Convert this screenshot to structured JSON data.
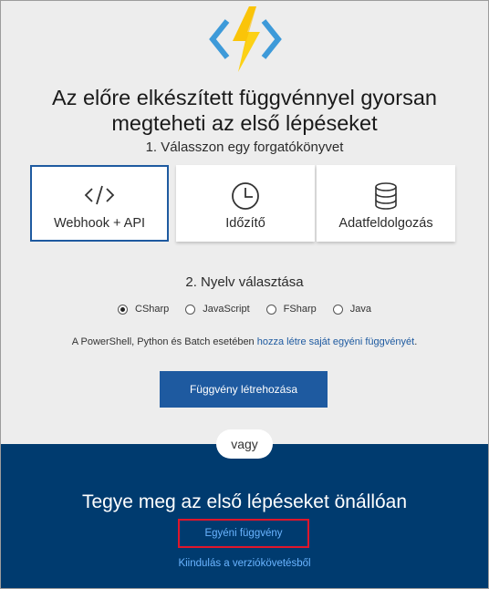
{
  "header": {
    "logo_icon": "azure-functions-lightning-icon",
    "headline_line1": "Az előre elkészített függvénnyel gyorsan",
    "headline_line2": "megteheti az első lépéseket",
    "step1_label": "1. Válasszon egy forgatókönyvet"
  },
  "scenarios": [
    {
      "label": "Webhook + API",
      "icon": "code-icon",
      "selected": true
    },
    {
      "label": "Időzítő",
      "icon": "clock-icon",
      "selected": false
    },
    {
      "label": "Adatfeldolgozás",
      "icon": "database-icon",
      "selected": false
    }
  ],
  "language": {
    "step2_label": "2. Nyelv választása",
    "options": [
      {
        "label": "CSharp",
        "checked": true
      },
      {
        "label": "JavaScript",
        "checked": false
      },
      {
        "label": "FSharp",
        "checked": false
      },
      {
        "label": "Java",
        "checked": false
      }
    ]
  },
  "note": {
    "prefix": "A PowerShell, Python és Batch esetében ",
    "link": "hozza létre saját egyéni függvényét",
    "suffix": "."
  },
  "create_button": "Függvény létrehozása",
  "divider_label": "vagy",
  "bottom": {
    "title": "Tegye meg az első lépéseket önállóan",
    "custom_function_link": "Egyéni függvény",
    "version_control_link": "Kiindulás a verziókövetésből"
  },
  "colors": {
    "accent_blue": "#1e5aa0",
    "dark_navy": "#003b6f",
    "highlight_red": "#e0162b",
    "link_light_blue": "#6ab4ff",
    "bolt_yellow": "#fcd116",
    "bracket_blue": "#3d9ad9"
  }
}
